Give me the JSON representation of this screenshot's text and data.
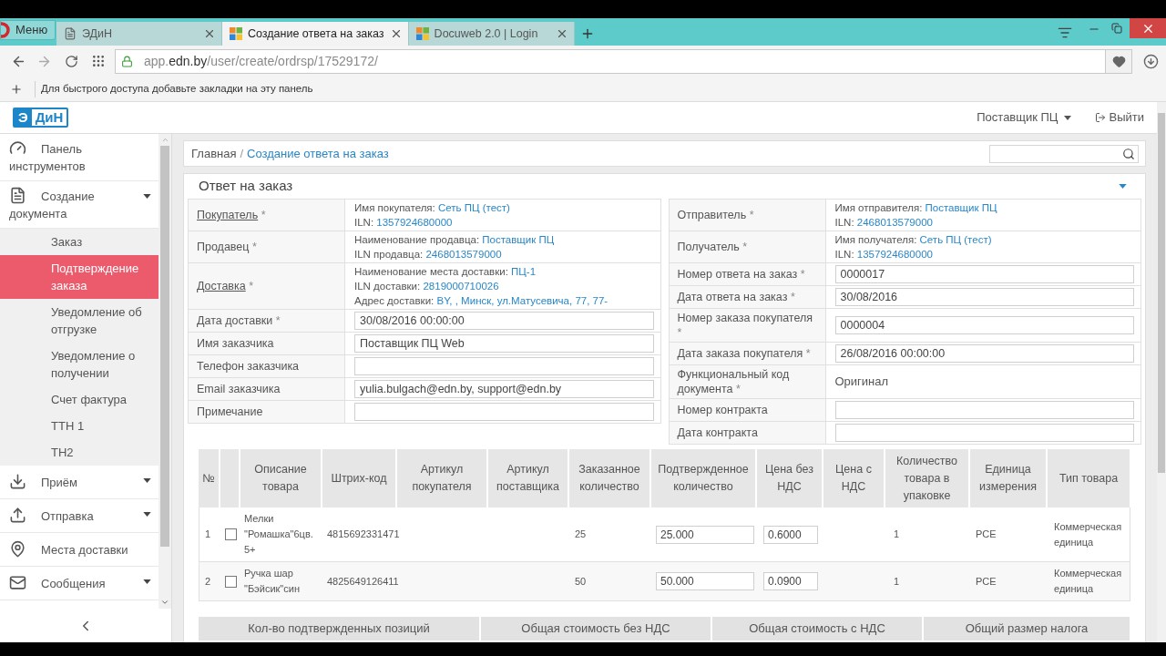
{
  "browser": {
    "menu_button": "Меню",
    "tabs": [
      {
        "title": "ЭДиН",
        "selected": false
      },
      {
        "title": "Создание ответа на заказ",
        "selected": true
      },
      {
        "title": "Docuweb 2.0 | Login",
        "selected": false
      }
    ],
    "address": {
      "prefix": "app.",
      "domain": "edn.by",
      "path": "/user/create/ordrsp/17529172/"
    },
    "bookmarks_hint": "Для быстрого доступа добавьте закладки на эту панель"
  },
  "header": {
    "logo": {
      "left": "Э",
      "right": "ДиН"
    },
    "user_menu": "Поставщик ПЦ",
    "logout": "Выйти"
  },
  "sidebar": {
    "items": [
      {
        "label": "Панель инструментов",
        "kind": "link"
      },
      {
        "label": "Создание документа",
        "kind": "group",
        "children": [
          {
            "label": "Заказ",
            "selected": false
          },
          {
            "label": "Подтверждение заказа",
            "selected": true
          },
          {
            "label": "Уведомление об отгрузке",
            "selected": false
          },
          {
            "label": "Уведомление о получении",
            "selected": false
          },
          {
            "label": "Счет фактура",
            "selected": false
          },
          {
            "label": "ТТН 1",
            "selected": false
          },
          {
            "label": "ТН2",
            "selected": false
          }
        ]
      },
      {
        "label": "Приём",
        "kind": "group"
      },
      {
        "label": "Отправка",
        "kind": "group"
      },
      {
        "label": "Места доставки",
        "kind": "link"
      },
      {
        "label": "Сообщения",
        "kind": "group"
      }
    ]
  },
  "breadcrumb": {
    "items": [
      {
        "label": "Главная",
        "kind": "text"
      },
      {
        "label": "Создание ответа на заказ",
        "kind": "link"
      }
    ],
    "separator": "/"
  },
  "form": {
    "title": "Ответ на заказ",
    "left": [
      {
        "label": "Покупатель",
        "required_mark": "*",
        "underlined": true,
        "kind": "party",
        "lines": [
          {
            "label": "Имя покупателя:",
            "value": "Сеть ПЦ (тест)"
          },
          {
            "label": "ILN:",
            "value": "1357924680000"
          }
        ]
      },
      {
        "label": "Продавец",
        "required_mark": "*",
        "underlined": false,
        "kind": "party",
        "lines": [
          {
            "label": "Наименование продавца:",
            "value": "Поставщик ПЦ"
          },
          {
            "label": "ILN продавца:",
            "value": "2468013579000"
          }
        ]
      },
      {
        "label": "Доставка",
        "required_mark": "*",
        "underlined": true,
        "kind": "party",
        "lines": [
          {
            "label": "Наименование места доставки:",
            "value": "ПЦ-1"
          },
          {
            "label": "ILN доставки:",
            "value": "2819000710026"
          },
          {
            "label": "Адрес доставки:",
            "value": "BY, , Минск, ул.Матусевича, 77, 77-"
          }
        ]
      },
      {
        "label": "Дата доставки",
        "required_mark": "*",
        "underlined": false,
        "kind": "input",
        "value": "30/08/2016 00:00:00"
      },
      {
        "label": "Имя заказчика",
        "underlined": false,
        "kind": "input",
        "value": "Поставщик ПЦ Web"
      },
      {
        "label": "Телефон заказчика",
        "underlined": false,
        "kind": "input"
      },
      {
        "label": "Email заказчика",
        "underlined": false,
        "kind": "input",
        "value": "yulia.bulgach@edn.by, support@edn.by"
      },
      {
        "label": "Примечание",
        "underlined": false,
        "kind": "input"
      }
    ],
    "right": [
      {
        "label": "Отправитель",
        "required_mark": "*",
        "underlined": false,
        "kind": "party",
        "lines": [
          {
            "label": "Имя отправителя:",
            "value": "Поставщик ПЦ"
          },
          {
            "label": "ILN:",
            "value": "2468013579000"
          }
        ]
      },
      {
        "label": "Получатель",
        "required_mark": "*",
        "underlined": false,
        "kind": "party",
        "lines": [
          {
            "label": "Имя получателя:",
            "value": "Сеть ПЦ (тест)"
          },
          {
            "label": "ILN:",
            "value": "1357924680000"
          }
        ]
      },
      {
        "label": "Номер ответа на заказ",
        "required_mark": "*",
        "underlined": false,
        "kind": "input",
        "value": "0000017"
      },
      {
        "label": "Дата ответа на заказ",
        "required_mark": "*",
        "underlined": false,
        "kind": "input",
        "value": "30/08/2016"
      },
      {
        "label": "Номер заказа покупателя",
        "required_mark": "*",
        "underlined": false,
        "kind": "input",
        "value": "0000004"
      },
      {
        "label": "Дата заказа покупателя",
        "required_mark": "*",
        "underlined": false,
        "kind": "input",
        "value": "26/08/2016 00:00:00"
      },
      {
        "label": "Функциональный код документа",
        "required_mark": "*",
        "underlined": false,
        "kind": "text",
        "value": "Оригинал"
      },
      {
        "label": "Номер контракта",
        "underlined": false,
        "kind": "input"
      },
      {
        "label": "Дата контракта",
        "underlined": false,
        "kind": "input"
      }
    ]
  },
  "items_table": {
    "columns": [
      "№",
      "Описание товара",
      "Штрих-код",
      "Артикул покупателя",
      "Артикул поставщика",
      "Заказанное количество",
      "Подтвержденное количество",
      "Цена без НДС",
      "Цена с НДС",
      "Количество товара в упаковке",
      "Единица измерения",
      "Тип товара"
    ],
    "rows": [
      {
        "number": "1",
        "checked": false,
        "description": "Мелки \"Ромашка\"6цв. 5+",
        "barcode": "4815692331471",
        "ordered_qty": "25",
        "confirmed_qty": "25.000",
        "price_excl_vat": "0.6000",
        "pack_qty": "1",
        "unit": "PCE",
        "product_type": "Коммерческая единица"
      },
      {
        "number": "2",
        "checked": false,
        "description": "Ручка шар \"Бэйсик\"син",
        "barcode": "4825649126411",
        "ordered_qty": "50",
        "confirmed_qty": "50.000",
        "price_excl_vat": "0.0900",
        "pack_qty": "1",
        "unit": "PCE",
        "product_type": "Коммерческая единица"
      }
    ]
  },
  "summary": {
    "columns": [
      "Кол-во подтвержденных позиций",
      "Общая стоимость без НДС",
      "Общая стоимость с НДС",
      "Общий размер налога"
    ]
  }
}
